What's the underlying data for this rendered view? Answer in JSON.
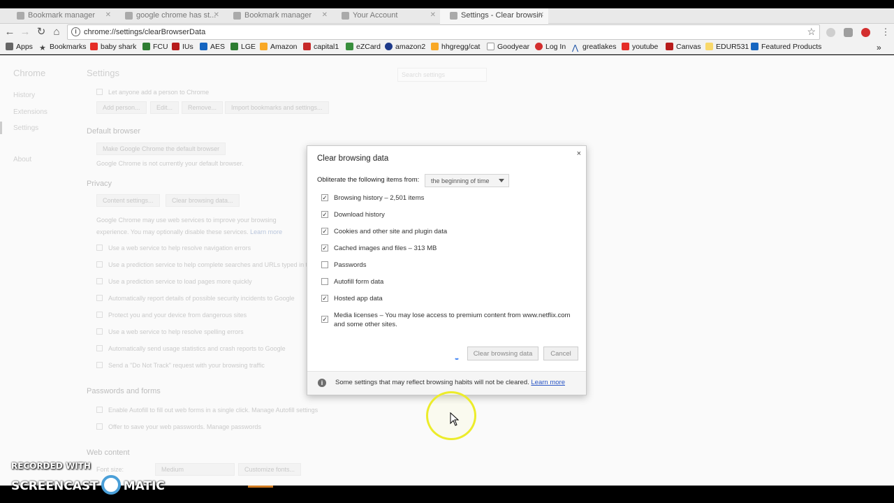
{
  "tabs": [
    {
      "label": "Bookmark manager"
    },
    {
      "label": "google chrome has st..."
    },
    {
      "label": "Bookmark manager"
    },
    {
      "label": "Your Account"
    },
    {
      "label": "Settings - Clear browsin"
    }
  ],
  "omnibox": {
    "url": "chrome://settings/clearBrowserData"
  },
  "bookmarks": [
    {
      "label": "Apps",
      "color": "#555555"
    },
    {
      "label": "Bookmarks",
      "color": "#444444"
    },
    {
      "label": "baby shark",
      "color": "#e52d27"
    },
    {
      "label": "FCU",
      "color": "#2e7d32"
    },
    {
      "label": "IUs",
      "color": "#b71c1c"
    },
    {
      "label": "AES",
      "color": "#1565c0"
    },
    {
      "label": "LGE",
      "color": "#2e7d32"
    },
    {
      "label": "Amazon",
      "color": "#f9a825"
    },
    {
      "label": "capital1",
      "color": "#c62828"
    },
    {
      "label": "eZCard",
      "color": "#388e3c"
    },
    {
      "label": "amazon2",
      "color": "#1e3a8a"
    },
    {
      "label": "hhgregg/cat",
      "color": "#f9a825"
    },
    {
      "label": "Goodyear",
      "color": "#9e9e9e"
    },
    {
      "label": "Log In",
      "color": "#d32f2f"
    },
    {
      "label": "greatlakes",
      "color": "#0d47a1"
    },
    {
      "label": "youtube",
      "color": "#e52d27"
    },
    {
      "label": "Canvas",
      "color": "#b71c1c"
    },
    {
      "label": "EDUR531",
      "color": "#f9a825"
    },
    {
      "label": "Featured Products",
      "color": "#1565c0"
    }
  ],
  "sidebar": {
    "title": "Chrome",
    "items": [
      "History",
      "Extensions",
      "Settings",
      "About"
    ]
  },
  "settings": {
    "title": "Settings",
    "search_placeholder": "Search settings",
    "people_row": "Let anyone add a person to Chrome",
    "people_buttons": [
      "Add person...",
      "Edit...",
      "Remove...",
      "Import bookmarks and settings..."
    ],
    "default_browser_heading": "Default browser",
    "make_default_button": "Make Google Chrome the default browser",
    "not_default_text": "Google Chrome is not currently your default browser.",
    "privacy_heading": "Privacy",
    "privacy_buttons": [
      "Content settings...",
      "Clear browsing data..."
    ],
    "privacy_text": "Google Chrome may use web services to improve your browsing experience. You may optionally disable these services.",
    "privacy_learn_more": "Learn more",
    "privacy_rows": [
      "Use a web service to help resolve navigation errors",
      "Use a prediction service to help complete searches and URLs typed in the address bar",
      "Use a prediction service to load pages more quickly",
      "Automatically report details of possible security incidents to Google",
      "Protect you and your device from dangerous sites",
      "Use a web service to help resolve spelling errors",
      "Automatically send usage statistics and crash reports to Google",
      "Send a \"Do Not Track\" request with your browsing traffic"
    ],
    "passwords_heading": "Passwords and forms",
    "passwords_rows": [
      "Enable Autofill to fill out web forms in a single click. Manage Autofill settings",
      "Offer to save your web passwords. Manage passwords"
    ],
    "web_content_heading": "Web content",
    "font_size_label": "Font size:",
    "font_size_value": "Medium",
    "customize_fonts_button": "Customize fonts..."
  },
  "dialog": {
    "title": "Clear browsing data",
    "close": "×",
    "obliterate_label": "Obliterate the following items from:",
    "time_range": "the beginning of time",
    "options": [
      {
        "label": "Browsing history",
        "detail": "2,501 items",
        "checked": true
      },
      {
        "label": "Download history",
        "detail": "",
        "checked": true
      },
      {
        "label": "Cookies and other site and plugin data",
        "detail": "",
        "checked": true
      },
      {
        "label": "Cached images and files",
        "detail": "313 MB",
        "checked": true
      },
      {
        "label": "Passwords",
        "detail": "",
        "checked": false
      },
      {
        "label": "Autofill form data",
        "detail": "",
        "checked": false
      },
      {
        "label": "Hosted app data",
        "detail": "",
        "checked": true
      },
      {
        "label": "Media licenses",
        "detail": "You may lose access to premium content from www.netflix.com",
        "detail2": "and some other sites.",
        "checked": true
      }
    ],
    "clear_button": "Clear browsing data",
    "cancel_button": "Cancel",
    "footer_text": "Some settings that may reflect browsing habits will not be cleared.",
    "footer_link": "Learn more"
  },
  "watermark": {
    "line1": "RECORDED WITH",
    "line2_left": "SCREENCAST",
    "line2_right": "MATIC"
  }
}
